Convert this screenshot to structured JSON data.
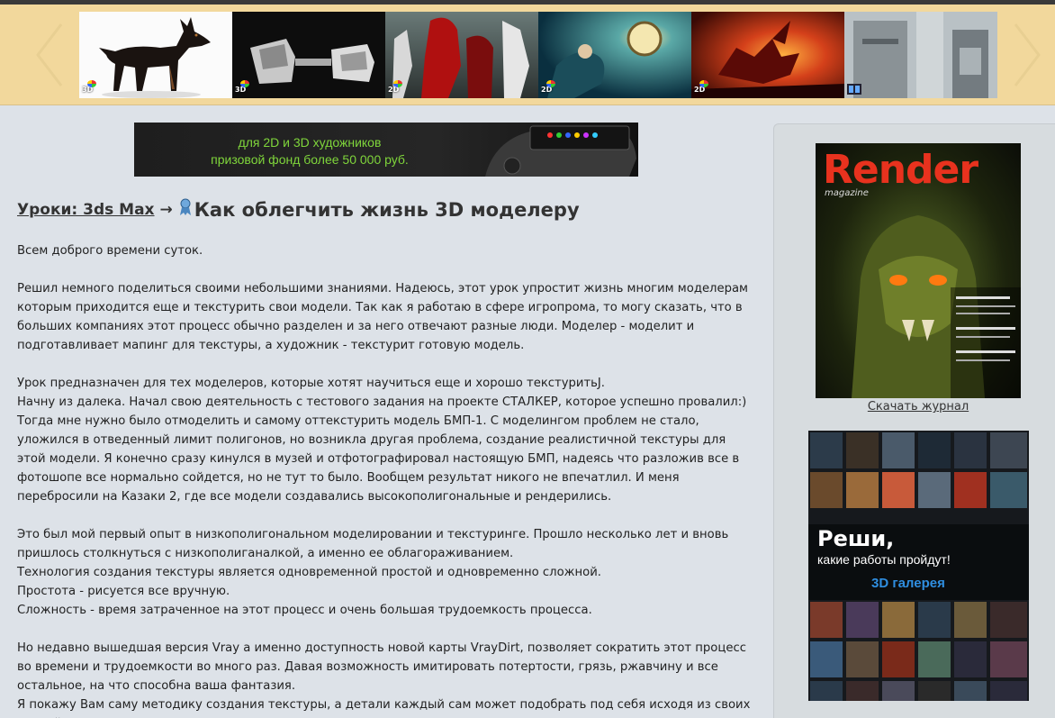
{
  "gallery": {
    "thumbs": [
      {
        "label": "3D",
        "icon": "doberman-dog-icon"
      },
      {
        "label": "3D",
        "icon": "robotic-hands-icon"
      },
      {
        "label": "2D",
        "icon": "red-demon-figures-icon"
      },
      {
        "label": "2D",
        "icon": "underwater-figure-icon"
      },
      {
        "label": "2D",
        "icon": "red-dragon-icon"
      },
      {
        "label": "",
        "icon": "industrial-scene-icon"
      }
    ]
  },
  "banner": {
    "line1": "для 2D и 3D художников",
    "line2": "призовой фонд более 50 000 руб."
  },
  "header": {
    "breadcrumb": "Уроки: 3ds Max",
    "separator": "→",
    "title": "Как облегчить жизнь 3D моделеру"
  },
  "article": {
    "paragraphs": [
      [
        "Всем доброго времени суток."
      ],
      [
        "Решил немного поделиться своими небольшими знаниями. Надеюсь, этот урок упростит жизнь многим моделерам которым приходится еще и текстурить свои модели. Так как я работаю в сфере игропрома, то могу сказать, что в больших компаниях этот процесс обычно разделен и за него отвечают разные люди. Моделер - моделит и подготавливает мапинг для текстуры, а художник - текстурит готовую модель."
      ],
      [
        "Урок предназначен для тех моделеров, которые хотят научиться еще и хорошо текстуритьJ.",
        "Начну из далека. Начал свою деятельность с тестового задания на проекте СТАЛКЕР, которое успешно провалил:)",
        "Тогда мне нужно было отмоделить и самому оттекстурить модель БМП-1. С моделингом проблем не стало, уложился в отведенный лимит полигонов, но возникла другая проблема, создание реалистичной текстуры для этой модели. Я конечно сразу кинулся в музей и отфотографировал настоящую БМП, надеясь что разложив все в фотошопе все нормально сойдется, но не тут то было. Вообщем результат никого не впечатлил. И меня перебросили на Казаки 2, где все модели создавались высокополигональные и рендерились."
      ],
      [
        "Это был мой первый опыт в низкополигональном моделировании и текстуринге. Прошло несколько лет и вновь пришлось столкнуться с низкополиганалкой, а именно ее облагораживанием.",
        "Технология создания текстуры является одновременной простой и одновременно сложной.",
        "Простота - рисуется все вручную.",
        "Сложность - время затраченное на этот процесс и очень большая трудоемкость процесса."
      ],
      [
        "Но недавно вышедшая версия Vray а именно доступность новой карты VrayDirt, позволяет сократить этот процесс во времени и трудоемкости во много раз. Давая возможность имитировать потертости, грязь, ржавчину и все остальное, на что способна ваша фантазия.",
        "Я покажу Вам саму методику создания текстуры, а детали каждый сам может подобрать под себя исходя из своих знаний и"
      ]
    ]
  },
  "sidebar": {
    "magazine_title": "Render",
    "magazine_sub": "magazine",
    "download_link": "Скачать журнал",
    "ad_line1": "Реши,",
    "ad_line2": "какие работы пройдут!",
    "ad_line3": "3D галерея"
  }
}
